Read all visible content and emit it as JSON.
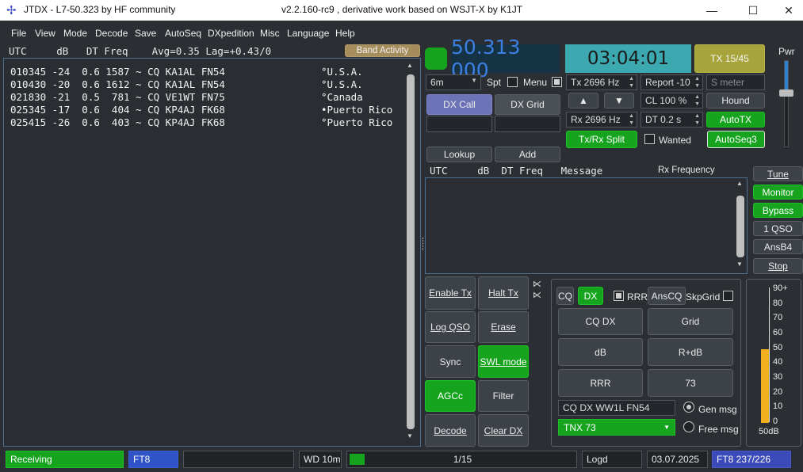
{
  "titlebar": {
    "app": "JTDX - L7-50.323  by HF community",
    "version": "v2.2.160-rc9 , derivative work based on WSJT-X by K1JT",
    "minimize": "—",
    "maximize": "☐",
    "close": "✕"
  },
  "menu": [
    "File",
    "View",
    "Mode",
    "Decode",
    "Save",
    "AutoSeq",
    "DXpedition",
    "Misc",
    "Language",
    "Help"
  ],
  "band_header": {
    "cols": "UTC     dB   DT Freq    Avg=0.35 Lag=+0.43/0",
    "band_activity": "Band Activity"
  },
  "band_rows": [
    {
      "text": "010345 -24  0.6 1587 ~ CQ KA1AL FN54",
      "country": "°U.S.A."
    },
    {
      "text": "010430 -20  0.6 1612 ~ CQ KA1AL FN54",
      "country": "°U.S.A."
    },
    {
      "text": "021830 -21  0.5  781 ~ CQ VE1WT FN75",
      "country": "°Canada"
    },
    {
      "text": "025345 -17  0.6  404 ~ CQ KP4AJ FK68",
      "country": "•Puerto Rico"
    },
    {
      "text": "025415 -26  0.6  403 ~ CQ KP4AJ FK68",
      "country": "°Puerto Rico"
    }
  ],
  "freq": "50.313 000",
  "clock": "03:04:01",
  "tx_slot": "TX 15/45",
  "pwr": "Pwr",
  "band": "6m",
  "spt": "Spt",
  "menu_chk": "Menu",
  "tx_freq": "Tx  2696  Hz",
  "rx_freq": "Rx  2696  Hz",
  "report": "Report -10",
  "smeter": "S meter",
  "cl": "CL  100 %",
  "dt": "DT 0.2 s",
  "hound": "Hound",
  "autotx": "AutoTX",
  "autoseq3": "AutoSeq3",
  "dxcall_btn": "DX Call",
  "dxgrid_btn": "DX Grid",
  "up_arrow": "▲",
  "down_arrow": "▼",
  "txrx_split": "Tx/Rx Split",
  "wanted": "Wanted",
  "lookup": "Lookup",
  "add": "Add",
  "rx_header": {
    "utc": "UTC",
    "db": "dB",
    "dt": "DT",
    "freq": "Freq",
    "msg": "Message",
    "rxf": "Rx Frequency"
  },
  "right_btns": [
    "Tune",
    "Monitor",
    "Bypass",
    "1 QSO",
    "AnsB4",
    "Stop"
  ],
  "left_btns": [
    [
      "Enable Tx",
      "Halt Tx"
    ],
    [
      "Log QSO",
      "Erase"
    ],
    [
      "Sync",
      "SWL mode"
    ],
    [
      "AGCc",
      "Filter"
    ],
    [
      "Decode",
      "Clear DX"
    ]
  ],
  "msg_panel": {
    "cq": "CQ",
    "dx": "DX",
    "rrr_chk": "RRR",
    "anscq": "AnsCQ",
    "skpgrid": "SkpGrid",
    "grid": [
      [
        "CQ DX",
        "Grid"
      ],
      [
        "dB",
        "R+dB"
      ],
      [
        "RRR",
        "73"
      ]
    ],
    "genmsg_value": "CQ DX WW1L FN54",
    "genmsg": "Gen msg",
    "freemsg_value": "TNX 73",
    "freemsg": "Free msg"
  },
  "meter": {
    "ticks": [
      "90+",
      "80",
      "70",
      "60",
      "50",
      "40",
      "30",
      "20",
      "10",
      "0"
    ],
    "value_db": 50,
    "label": "50dB"
  },
  "statusbar": {
    "receiving": "Receiving",
    "mode": "FT8",
    "wd": "WD 10m",
    "progress": "1/15",
    "progress_frac": 0.067,
    "logd": "Logd",
    "date": "03.07.2025",
    "mode_count": "FT8  237/226"
  },
  "colors": {
    "green": "#16a41f",
    "freq_bg": "#153344",
    "freq_text": "#3d7fe0",
    "clock_bg": "#3ca9b1",
    "olive": "#a6a43a",
    "meter": "#f2b01e"
  }
}
